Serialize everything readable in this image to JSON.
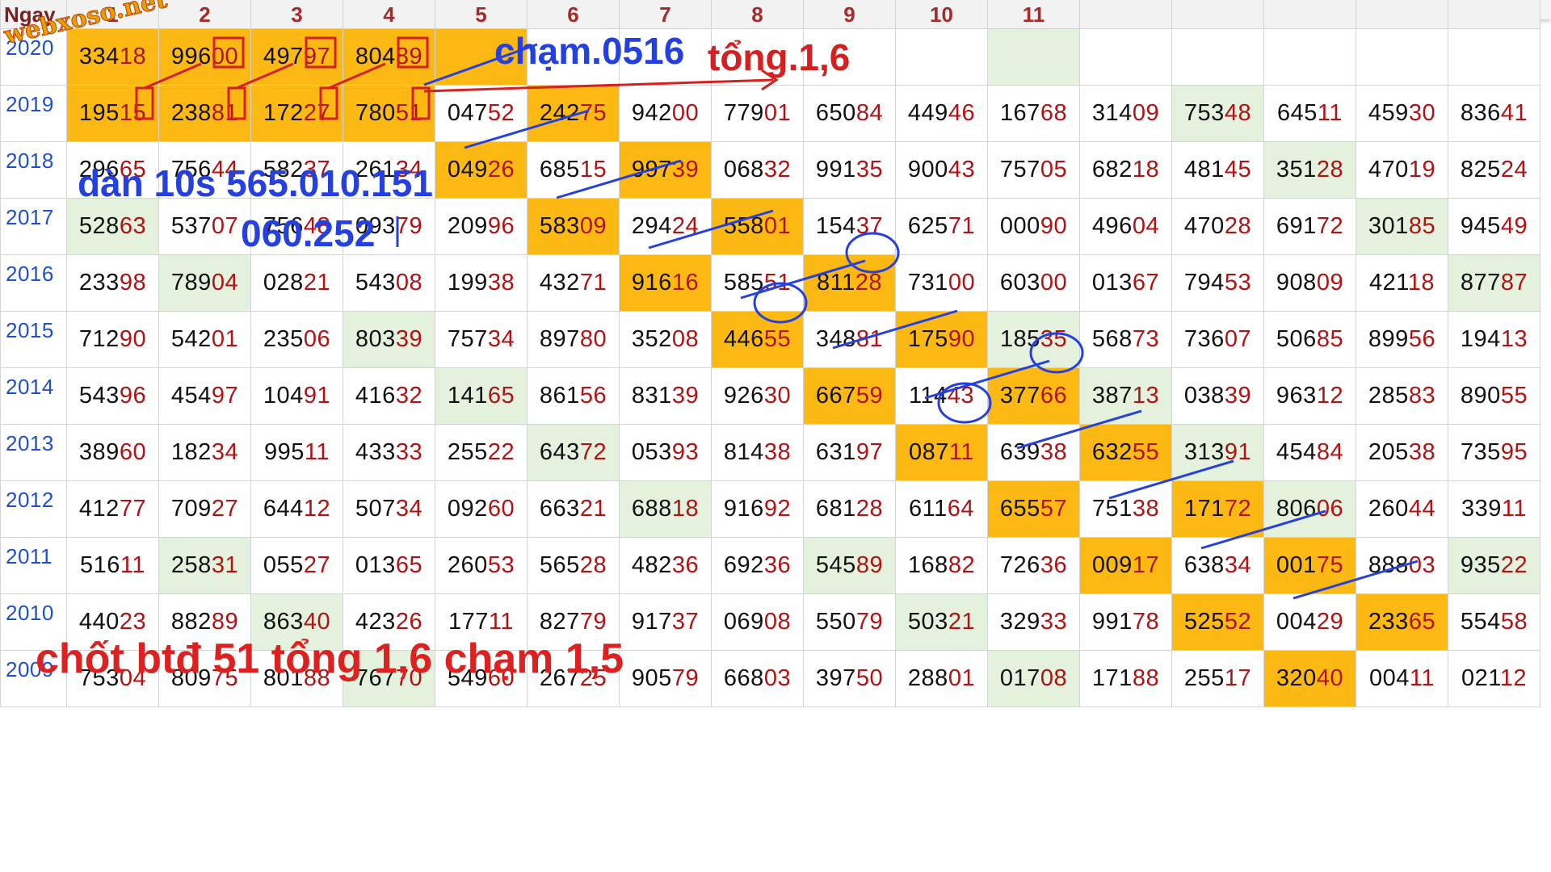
{
  "header": {
    "first": "Ngay",
    "cols": [
      "1",
      "2",
      "3",
      "4",
      "5",
      "6",
      "7",
      "8",
      "9",
      "10",
      "11",
      "",
      "",
      "",
      "",
      ""
    ]
  },
  "rows": [
    {
      "year": "2020",
      "cells": [
        "33418",
        "99600",
        "49797",
        "80489",
        "",
        "",
        "",
        "",
        "",
        "",
        "",
        "",
        "",
        "",
        "",
        ""
      ]
    },
    {
      "year": "2019",
      "cells": [
        "19515",
        "23881",
        "17227",
        "78051",
        "04752",
        "24275",
        "94200",
        "77901",
        "65084",
        "44946",
        "16768",
        "31409",
        "75348",
        "64511",
        "45930",
        "83641"
      ]
    },
    {
      "year": "2018",
      "cells": [
        "29665",
        "75644",
        "58237",
        "26134",
        "04926",
        "68515",
        "99739",
        "06832",
        "99135",
        "90043",
        "75705",
        "68218",
        "48145",
        "35128",
        "47019",
        "82524"
      ]
    },
    {
      "year": "2017",
      "cells": [
        "52863",
        "53707",
        "75648",
        "09379",
        "20996",
        "58309",
        "29424",
        "55801",
        "15437",
        "62571",
        "00090",
        "49604",
        "47028",
        "69172",
        "30185",
        "94549"
      ]
    },
    {
      "year": "2016",
      "cells": [
        "23398",
        "78904",
        "02821",
        "54308",
        "19938",
        "43271",
        "91616",
        "58551",
        "81128",
        "73100",
        "60300",
        "01367",
        "79453",
        "90809",
        "42118",
        "87787"
      ]
    },
    {
      "year": "2015",
      "cells": [
        "71290",
        "54201",
        "23506",
        "80339",
        "75734",
        "89780",
        "35208",
        "44655",
        "34881",
        "17590",
        "18535",
        "56873",
        "73607",
        "50685",
        "89956",
        "19413"
      ]
    },
    {
      "year": "2014",
      "cells": [
        "54396",
        "45497",
        "10491",
        "41632",
        "14165",
        "86156",
        "83139",
        "92630",
        "66759",
        "11443",
        "37766",
        "38713",
        "03839",
        "96312",
        "28583",
        "89055"
      ]
    },
    {
      "year": "2013",
      "cells": [
        "38960",
        "18234",
        "99511",
        "43333",
        "25522",
        "64372",
        "05393",
        "81438",
        "63197",
        "08711",
        "63938",
        "63255",
        "31391",
        "45484",
        "20538",
        "73595"
      ]
    },
    {
      "year": "2012",
      "cells": [
        "41277",
        "70927",
        "64412",
        "50734",
        "09260",
        "66321",
        "68818",
        "91692",
        "68128",
        "61164",
        "65557",
        "75138",
        "17172",
        "80606",
        "26044",
        "33911"
      ]
    },
    {
      "year": "2011",
      "cells": [
        "51611",
        "25831",
        "05527",
        "01365",
        "26053",
        "56528",
        "48236",
        "69236",
        "54589",
        "16882",
        "72636",
        "00917",
        "63834",
        "00175",
        "88803",
        "93522"
      ]
    },
    {
      "year": "2010",
      "cells": [
        "44023",
        "88289",
        "86340",
        "42326",
        "17711",
        "82779",
        "91737",
        "06908",
        "55079",
        "50321",
        "32933",
        "99178",
        "52552",
        "00429",
        "23365",
        "55458"
      ]
    },
    {
      "year": "2009",
      "cells": [
        "75304",
        "80975",
        "80188",
        "76770",
        "54960",
        "26725",
        "90579",
        "66803",
        "39750",
        "28801",
        "01708",
        "17188",
        "25517",
        "32040",
        "00411",
        "02112"
      ]
    }
  ],
  "annotations": {
    "watermark": "webxoso.net",
    "cham": "chạm.0516",
    "tong": "tổng.1,6",
    "dan_line1": "dàn 10s 565.010.151",
    "dan_line2": "060.252",
    "conclusion": "chốt btđ 51 tổng 1,6 chạm 1,5"
  },
  "colors": {
    "highlight": "#fdb913",
    "green": "#e3f1dd",
    "digit_red": "#b01313",
    "year_blue": "#1f4fd1",
    "ann_blue": "#2540e0",
    "ann_red": "#d42020"
  }
}
